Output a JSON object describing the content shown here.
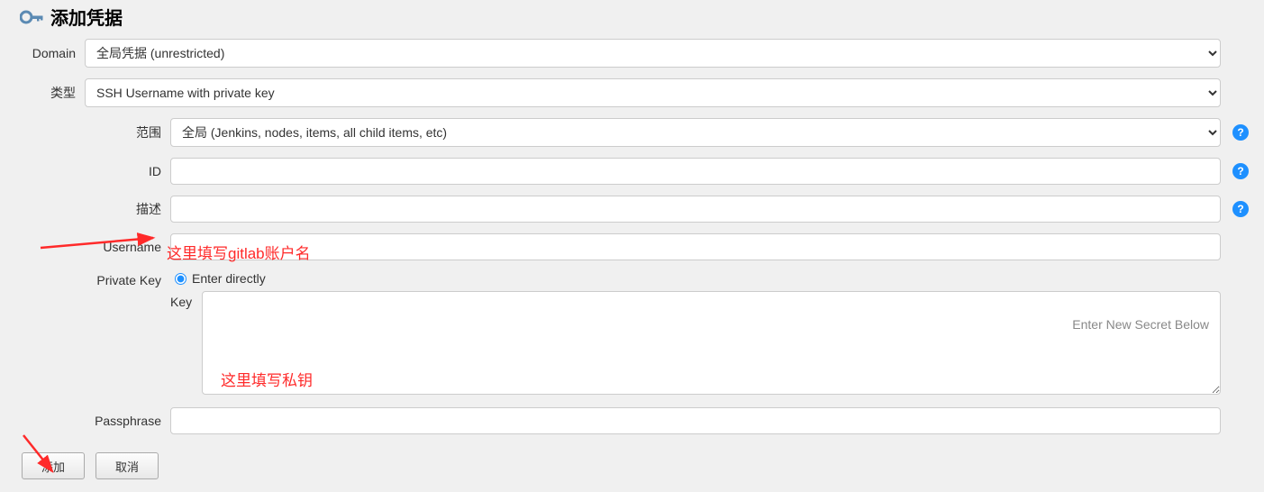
{
  "header": {
    "title": "添加凭据"
  },
  "form": {
    "domain_label": "Domain",
    "domain_value": "全局凭据 (unrestricted)",
    "type_label": "类型",
    "type_value": "SSH Username with private key",
    "scope_label": "范围",
    "scope_value": "全局 (Jenkins, nodes, items, all child items, etc)",
    "id_label": "ID",
    "id_value": "",
    "desc_label": "描述",
    "desc_value": "",
    "username_label": "Username",
    "username_value": "",
    "private_key_label": "Private Key",
    "enter_directly_label": "Enter directly",
    "key_label": "Key",
    "key_placeholder": "Enter New Secret Below",
    "passphrase_label": "Passphrase",
    "passphrase_value": ""
  },
  "buttons": {
    "add": "添加",
    "cancel": "取消"
  },
  "annotations": {
    "username_hint": "这里填写gitlab账户名",
    "key_hint": "这里填写私钥"
  }
}
